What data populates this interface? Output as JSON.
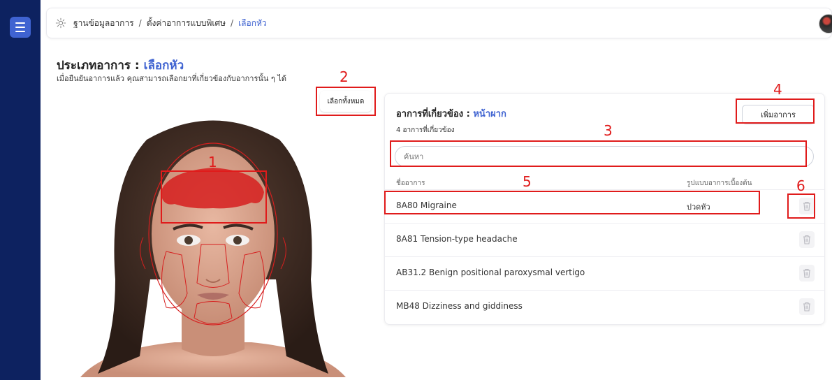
{
  "breadcrumb": {
    "items": [
      "ฐานข้อมูลอาการ",
      "ตั้งค่าอาการแบบพิเศษ",
      "เลือกหัว"
    ],
    "separator": "/"
  },
  "page": {
    "title_prefix": "ประเภทอาการ : ",
    "title_highlight": "เลือกหัว",
    "subtitle": "เมื่อยืนยันอาการแล้ว คุณสามารถเลือกยาที่เกี่ยวข้องกับอาการนั้น ๆ ได้"
  },
  "select_all_label": "เลือกทั้งหมด",
  "related": {
    "title_prefix": "อาการที่เกี่ยวข้อง : ",
    "title_highlight": "หน้าผาก",
    "count_text": "4 อาการที่เกี่ยวข้อง",
    "add_button": "เพิ่มอาการ",
    "search_placeholder": "ค้นหา",
    "col_name": "ชื่ออาการ",
    "col_pattern": "รูปแบบอาการเบื้องต้น",
    "rows": [
      {
        "name": "8A80 Migraine",
        "pattern": "ปวดหัว"
      },
      {
        "name": "8A81 Tension-type headache",
        "pattern": ""
      },
      {
        "name": "AB31.2 Benign positional paroxysmal vertigo",
        "pattern": ""
      },
      {
        "name": "MB48 Dizziness and giddiness",
        "pattern": ""
      }
    ]
  },
  "annotations": {
    "n1": "1",
    "n2": "2",
    "n3": "3",
    "n4": "4",
    "n5": "5",
    "n6": "6"
  },
  "colors": {
    "sidebar": "#0d2260",
    "accent": "#3f63d1",
    "annotation": "#e01b1b",
    "forehead_highlight": "#d61f1f"
  },
  "icons": {
    "menu": "hamburger-icon",
    "settings": "gear-icon",
    "delete": "trash-icon"
  }
}
